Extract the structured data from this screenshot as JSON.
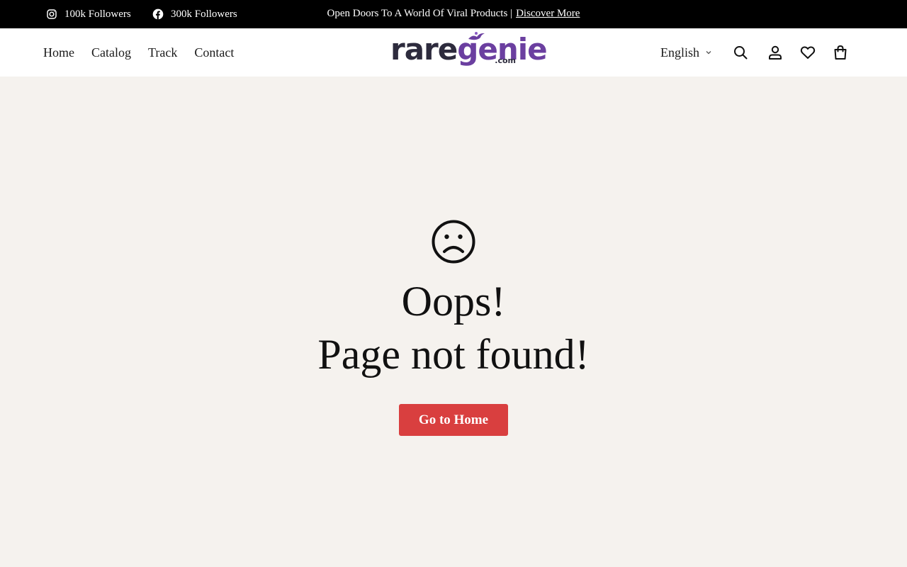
{
  "topbar": {
    "instagram": {
      "icon": "instagram-icon",
      "label": "100k Followers"
    },
    "facebook": {
      "icon": "facebook-icon",
      "label": "300k Followers"
    },
    "announcement": "Open Doors To A World Of Viral Products |",
    "announcement_link": "Discover More"
  },
  "header": {
    "nav": [
      "Home",
      "Catalog",
      "Track",
      "Contact"
    ],
    "logo": {
      "rare": "rare",
      "genie": "genie",
      "com": ".com"
    },
    "language": "English",
    "icons": [
      "search-icon",
      "account-icon",
      "heart-icon",
      "shopping-bag-icon"
    ]
  },
  "main": {
    "icon": "sad-face-icon",
    "line1": "Oops!",
    "line2": "Page not found!",
    "button": "Go to Home"
  },
  "colors": {
    "topbar_bg": "#000000",
    "page_bg": "#f5f2ee",
    "button_bg": "#d93f3f",
    "logo_dark": "#2d2b3d",
    "logo_purple": "#6b3fa0"
  }
}
